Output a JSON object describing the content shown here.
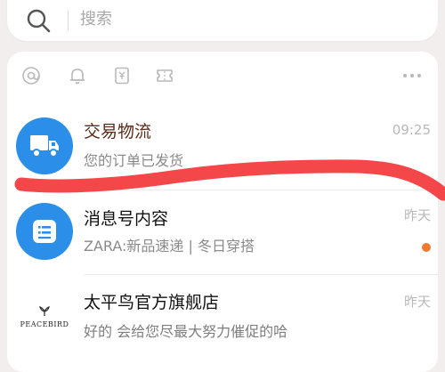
{
  "search": {
    "placeholder": "搜索"
  },
  "toolbar": {
    "icons": [
      "at-icon",
      "bell-icon",
      "receipt-icon",
      "ticket-icon",
      "more-icon"
    ]
  },
  "conversations": [
    {
      "title": "交易物流",
      "subtitle": "您的订单已发货",
      "time": "09:25",
      "avatar": "truck-icon",
      "title_color": "#5a2d1b"
    },
    {
      "title": "消息号内容",
      "subtitle": "ZARA:新品速递 | 冬日穿搭",
      "time": "昨天",
      "avatar": "message-icon",
      "unread": true,
      "dot_color": "#f07a2e"
    },
    {
      "title": "太平鸟官方旗舰店",
      "subtitle": "好的  会给您尽最大努力催促的哈",
      "time": "昨天",
      "avatar_text": "PEACEBIRD"
    }
  ],
  "colors": {
    "accent_blue": "#2b8ee9",
    "annotation_red": "#f2393c",
    "unread_dot": "#f07a2e"
  }
}
